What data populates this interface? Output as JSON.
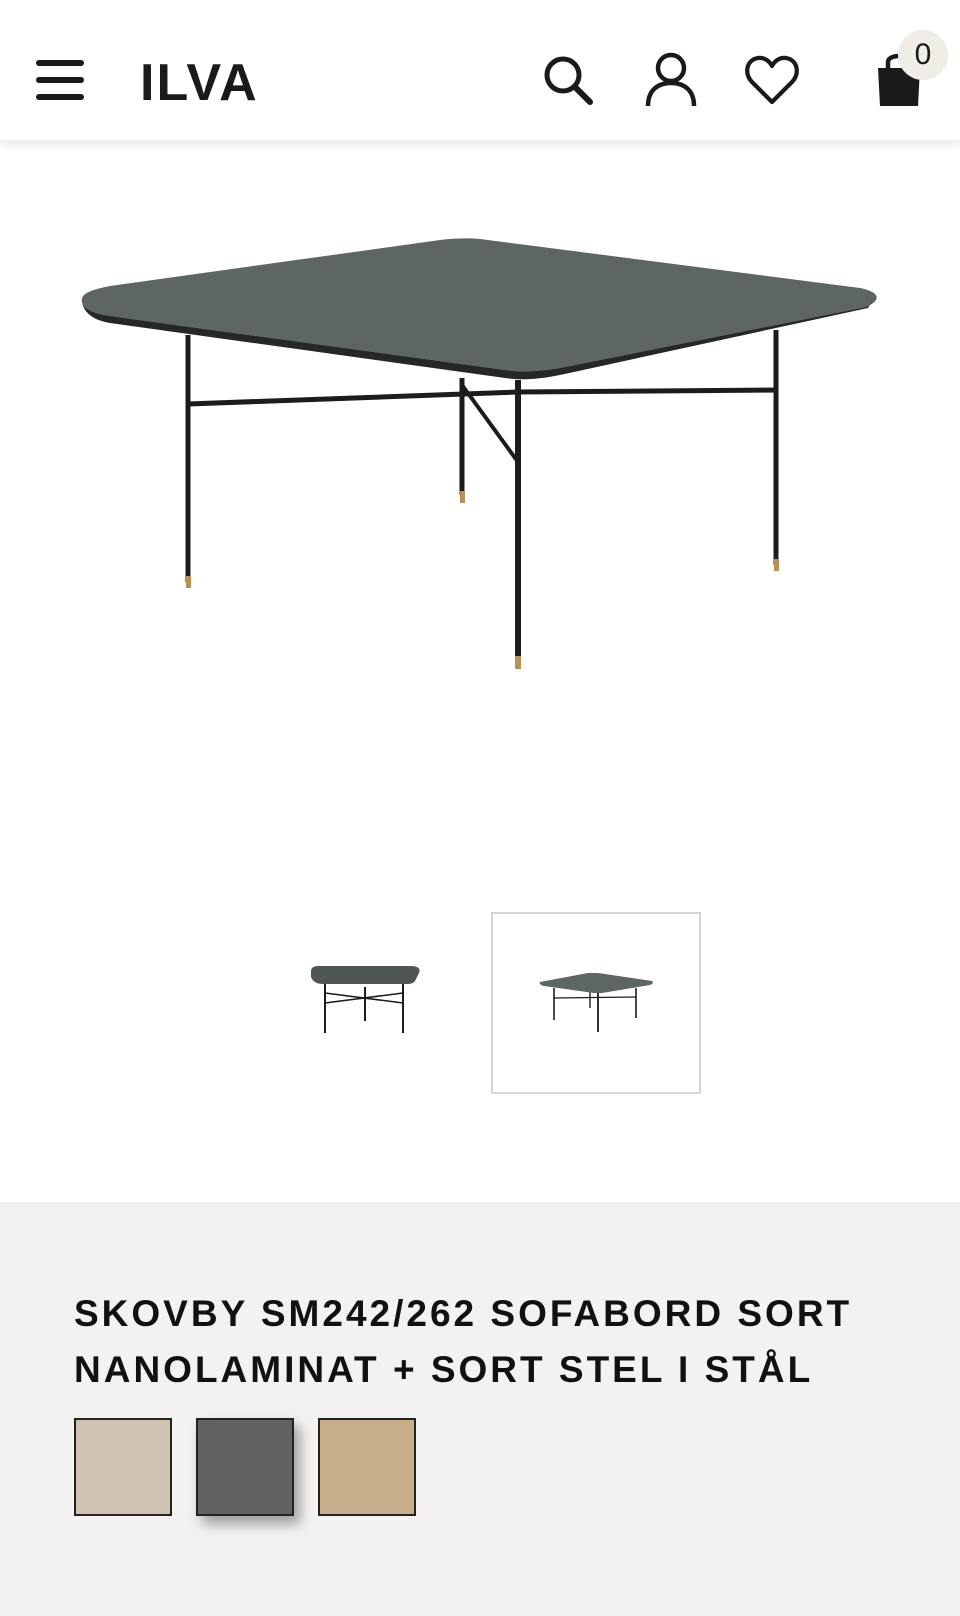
{
  "header": {
    "logo_text": "ILVA",
    "cart_count": "0"
  },
  "product": {
    "brand_model": "SKOVBY SM242/262",
    "description": " SOFABORD SORT NANOLAMINAT + SORT STEL I STÅL",
    "gallery": {
      "selected_thumbnail": 2,
      "thumbnail_count": 2
    },
    "swatches": [
      {
        "color": "#cfc2b1",
        "selected": false
      },
      {
        "color": "#616363",
        "selected": true
      },
      {
        "color": "#c7ae8b",
        "selected": false
      }
    ]
  },
  "icons": {
    "menu": "menu-icon",
    "search": "search-icon",
    "account": "account-icon",
    "wishlist": "heart-icon",
    "cart": "shopping-bag-icon"
  },
  "colors": {
    "tabletop": "#5e6565",
    "frame": "#1c1c1c",
    "feet": "#b8915a",
    "info_bg": "#f3f2f0"
  }
}
